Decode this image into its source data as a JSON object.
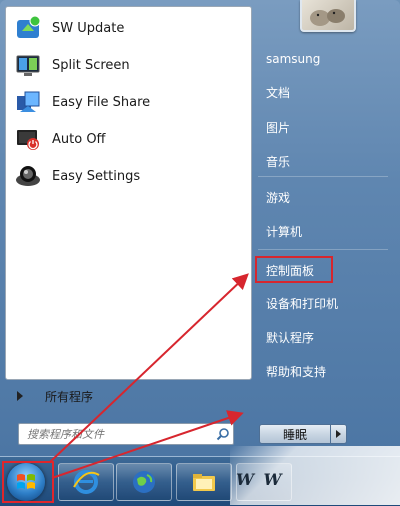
{
  "programs": [
    {
      "label": "SW Update",
      "icon": "sw-update-icon"
    },
    {
      "label": "Split Screen",
      "icon": "split-screen-icon"
    },
    {
      "label": "Easy File Share",
      "icon": "easy-file-share-icon"
    },
    {
      "label": "Auto Off",
      "icon": "auto-off-icon"
    },
    {
      "label": "Easy Settings",
      "icon": "easy-settings-icon"
    }
  ],
  "all_programs_label": "所有程序",
  "search": {
    "placeholder": "搜索程序和文件"
  },
  "right_pane": {
    "user_name": "samsung",
    "items": [
      "文档",
      "图片",
      "音乐",
      "游戏",
      "计算机",
      "控制面板",
      "设备和打印机",
      "默认程序",
      "帮助和支持"
    ]
  },
  "shutdown": {
    "label": "睡眠"
  },
  "watermark": "W W",
  "colors": {
    "highlight": "#d7262e",
    "menu_blue": "#5f86b0",
    "taskbar": "#2b5888"
  }
}
